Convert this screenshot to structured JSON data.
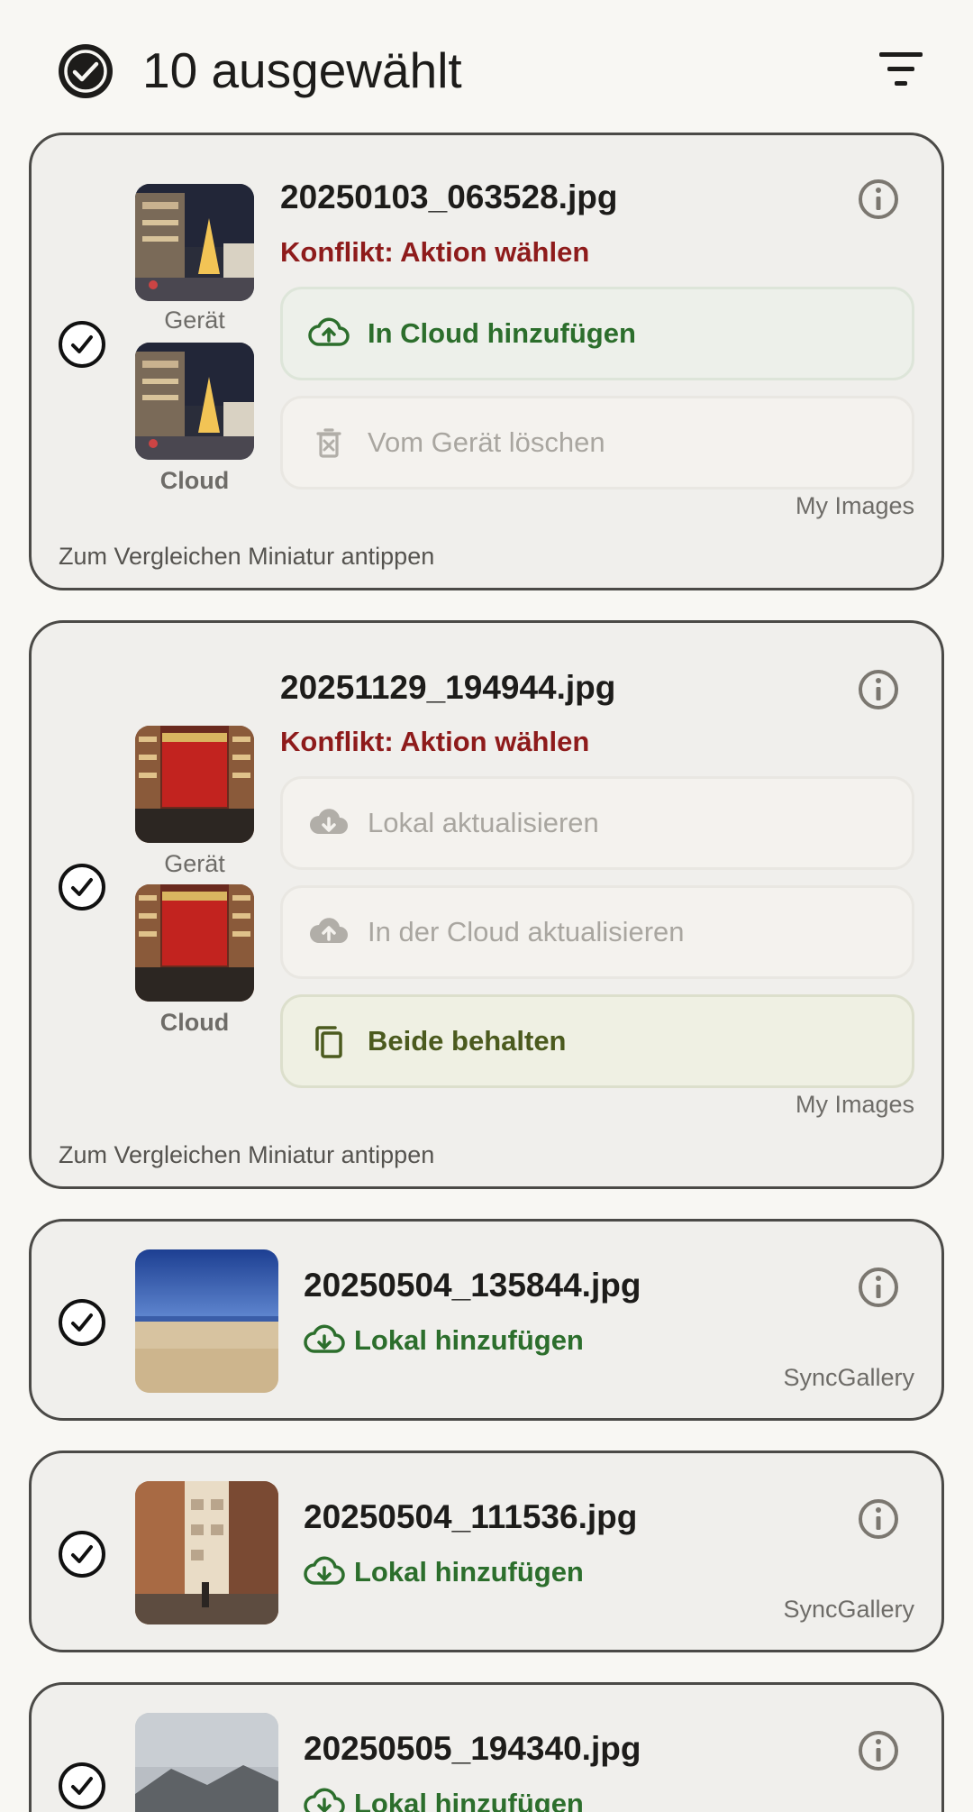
{
  "header": {
    "selected_text": "10 ausgewählt",
    "select_icon": "check-circle-icon",
    "filter_icon": "filter-icon"
  },
  "cards": [
    {
      "filename": "20250103_063528.jpg",
      "conflict": "Konflikt: Aktion wählen",
      "device_label": "Gerät",
      "cloud_label": "Cloud",
      "actions": [
        {
          "label": "In Cloud hinzufügen",
          "icon": "cloud-upload-icon",
          "state": "enabled"
        },
        {
          "label": "Vom Gerät löschen",
          "icon": "delete-icon",
          "state": "disabled"
        }
      ],
      "folder": "My Images",
      "hint": "Zum Vergleichen Miniatur antippen"
    },
    {
      "filename": "20251129_194944.jpg",
      "conflict": "Konflikt: Aktion wählen",
      "device_label": "Gerät",
      "cloud_label": "Cloud",
      "actions": [
        {
          "label": "Lokal aktualisieren",
          "icon": "cloud-download-icon",
          "state": "disabled"
        },
        {
          "label": "In der Cloud aktualisieren",
          "icon": "cloud-upload-icon",
          "state": "disabled"
        },
        {
          "label": "Beide behalten",
          "icon": "copy-icon",
          "state": "enabled"
        }
      ],
      "folder": "My Images",
      "hint": "Zum Vergleichen Miniatur antippen"
    },
    {
      "filename": "20250504_135844.jpg",
      "status": "Lokal hinzufügen",
      "folder": "SyncGallery"
    },
    {
      "filename": "20250504_111536.jpg",
      "status": "Lokal hinzufügen",
      "folder": "SyncGallery"
    },
    {
      "filename": "20250505_194340.jpg",
      "status": "Lokal hinzufügen"
    }
  ],
  "colors": {
    "background": "#f8f7f3",
    "card": "#f0efec",
    "card_border": "#4b4a47",
    "conflict_red": "#8e1b1b",
    "action_green": "#2c6e2c",
    "keep_both_olive": "#4b5a1e",
    "disabled_text": "#a9a6a0"
  }
}
